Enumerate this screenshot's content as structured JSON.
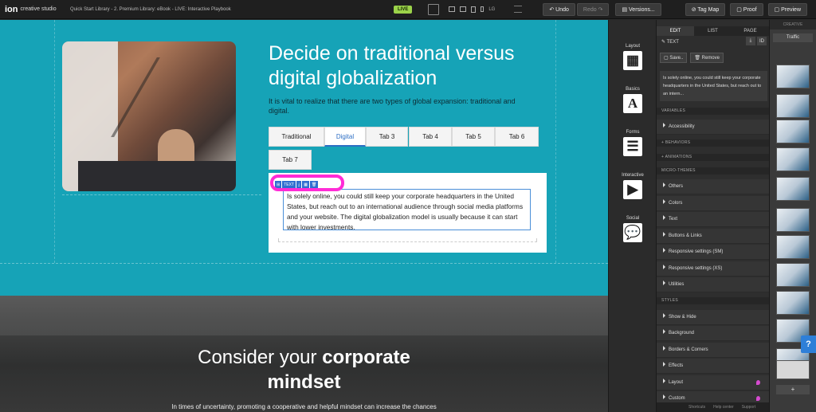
{
  "app": {
    "logo_mark": "ion",
    "logo_sub": "creative studio"
  },
  "topbar": {
    "breadcrumb": "Quick Start Library - 2. Premium Library: eBook - LIVE: Interactive Playbook",
    "live_badge": "LIVE",
    "device_label_lg": "LG",
    "undo": "↶ Undo",
    "redo": "Redo ↷",
    "versions": "▤ Versions...",
    "tag_map": "⊘ Tag Map",
    "proof": "▢ Proof",
    "preview": "▢ Preview"
  },
  "canvas": {
    "heading": "Decide on traditional versus digital globalization",
    "lead": "It is vital to realize that there are two types of global expansion: traditional and digital.",
    "tabs": [
      "Traditional",
      "Digital",
      "Tab 3",
      "Tab 4",
      "Tab 5",
      "Tab 6",
      "Tab 7"
    ],
    "active_tab": "Digital",
    "body_text": "Is solely online, you could still keep your corporate headquarters in the United States, but reach out to an international audience through social media platforms and your website. The digital globalization model is usually because it can start with lower investments.",
    "mini_toolbar": [
      "TEXT",
      "⤓",
      "▦",
      "🗑"
    ],
    "section2_heading_light": "Consider your",
    "section2_heading_bold": "corporate",
    "section2_heading_line2": "mindset",
    "section2_text": "In times of uncertainty, promoting a cooperative and helpful mindset can increase the chances",
    "highlight_color": "#ff2bd6",
    "accent": "#16a3b7"
  },
  "components": [
    {
      "label": "Layout",
      "icon": "layout-icon",
      "glyph": "▦"
    },
    {
      "label": "Basics",
      "icon": "text-a-icon",
      "glyph": "A"
    },
    {
      "label": "Forms",
      "icon": "form-icon",
      "glyph": "☰"
    },
    {
      "label": "Interactive",
      "icon": "play-icon",
      "glyph": "▶"
    },
    {
      "label": "Social",
      "icon": "chat-icon",
      "glyph": "💬"
    }
  ],
  "props": {
    "tabs": [
      "EDIT",
      "LIST",
      "PAGE"
    ],
    "header": "✎ TEXT",
    "save": "▢ Save..",
    "remove": "🗑 Remove",
    "preview_text": "Is solely online, you could still keep your corporate headquarters in the United States, but reach out to an intern...",
    "sec_variables": "VARIABLES",
    "accessibility": "Accessibility",
    "behaviors": "+ BEHAVIORS",
    "animations": "+ ANIMATIONS",
    "sec_micro": "MICRO-THEMES",
    "micro_items": [
      "Others",
      "Colors",
      "Text",
      "Buttons & Links",
      "Responsive settings (SM)",
      "Responsive settings (XS)",
      "Utilities"
    ],
    "sec_styles": "STYLES",
    "style_items": [
      "Show & Hide",
      "Background",
      "Borders & Corners",
      "Effects",
      "Layout",
      "Custom"
    ],
    "bottom_links": [
      "Shortcuts",
      "Help center",
      "Support"
    ]
  },
  "creative": {
    "title": "CREATIVE",
    "select": "Traffic",
    "add": "+"
  },
  "help": "?"
}
